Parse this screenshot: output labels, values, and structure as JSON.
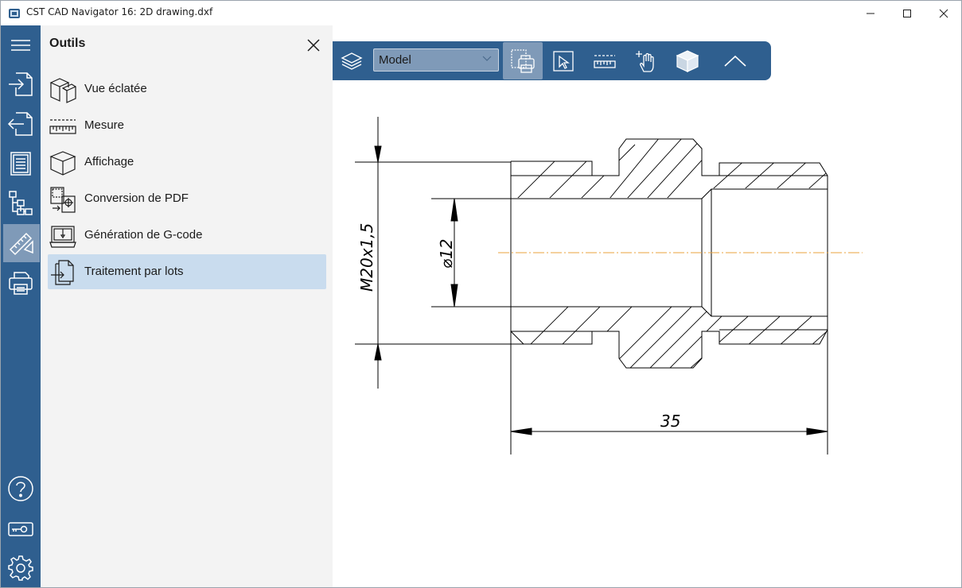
{
  "window": {
    "title": "CST CAD Navigator 16: 2D drawing.dxf"
  },
  "rail": {
    "items": [
      {
        "icon": "hamburger-menu-icon"
      },
      {
        "icon": "import-icon"
      },
      {
        "icon": "export-icon"
      },
      {
        "icon": "document-properties-icon"
      },
      {
        "icon": "tree-structure-icon"
      },
      {
        "icon": "tools-icon",
        "active": true
      },
      {
        "icon": "print-icon"
      },
      {
        "icon": "help-icon"
      },
      {
        "icon": "license-key-icon"
      },
      {
        "icon": "settings-gear-icon"
      }
    ]
  },
  "panel": {
    "title": "Outils",
    "tools": [
      {
        "label": "Vue éclatée",
        "icon": "exploded-view-icon"
      },
      {
        "label": "Mesure",
        "icon": "ruler-icon"
      },
      {
        "label": "Affichage",
        "icon": "cube-icon"
      },
      {
        "label": "Conversion de PDF",
        "icon": "pdf-conversion-icon"
      },
      {
        "label": "Génération de G-code",
        "icon": "cnc-machine-icon"
      },
      {
        "label": "Traitement par lots",
        "icon": "batch-processing-icon",
        "selected": true
      }
    ]
  },
  "toolbar": {
    "layout_value": "Model"
  },
  "drawing": {
    "thread_dimension": "M20x1,5",
    "diameter_dimension": "⌀12",
    "length_dimension": "35",
    "centerline_color": "#e8a33c",
    "line_color": "#000000"
  },
  "colors": {
    "rail_bg": "#2f5f8f",
    "active_bg": "#7f9ab8",
    "panel_bg": "#f3f3f3",
    "selected_tool_bg": "#c9dcee"
  }
}
